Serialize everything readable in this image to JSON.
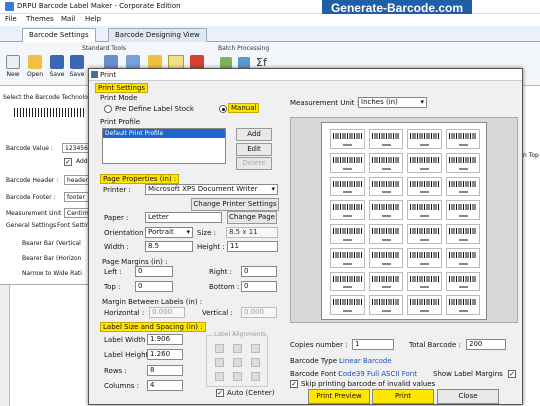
{
  "window": {
    "title": "DRPU Barcode Label Maker - Corporate Edition",
    "brand": "Generate-Barcode.com"
  },
  "menu": [
    "File",
    "Themes",
    "Mail",
    "Help"
  ],
  "tabs": [
    "Barcode Settings",
    "Barcode Designing View"
  ],
  "ribbon": {
    "standard_tools": "Standard Tools",
    "batch_processing": "Batch Processing",
    "buttons": [
      "New",
      "Open",
      "Save",
      "Save"
    ]
  },
  "left": {
    "technology": "Select the Barcode Technolog",
    "barcode_value_label": "Barcode Value :",
    "barcode_value": "123456",
    "add": "Add",
    "header_label": "Barcode Header :",
    "header": "header",
    "footer_label": "Barcode Footer :",
    "footer": "footer",
    "unit_label": "Measurement Unit :",
    "unit": "Centim",
    "general_tab": "General Settings",
    "font_tab": "Font Settin",
    "bearer_v": "Bearer Bar (Vertical",
    "bearer_h": "Bearer Bar (Horizon",
    "narrow_wide": "Narrow to Wide Rati",
    "right_top": "n Top"
  },
  "dialog": {
    "title": "Print",
    "print_settings": "Print Settings",
    "print_mode_label": "Print Mode",
    "mode_predefine": "Pre Define Label Stock",
    "mode_manual": "Manual",
    "print_profile_label": "Print Profile",
    "profile_items": [
      "Default Print Profile"
    ],
    "profile_add": "Add",
    "profile_edit": "Edit",
    "profile_delete": "Delete",
    "page_properties": "Page Properties (in) :",
    "printer_label": "Printer :",
    "printer": "Microsoft XPS Document Writer",
    "change_printer": "Change Printer Settings",
    "paper_label": "Paper :",
    "paper": "Letter",
    "change_page": "Change Page",
    "orientation_label": "Orientation :",
    "orientation": "Portrait",
    "size_label": "Size :",
    "size": "8.5 x 11",
    "width_label": "Width :",
    "width": "8.5",
    "height_label": "Height :",
    "height": "11",
    "page_margins": "Page Margins (in) :",
    "left_label": "Left :",
    "left": "0",
    "right_label": "Right :",
    "right": "0",
    "top_label": "Top :",
    "top": "0",
    "bottom_label": "Bottom :",
    "bottom": "0",
    "margin_between": "Margin Between Labels (in) :",
    "horizontal_label": "Horizontal :",
    "horizontal": "0.000",
    "vertical_label": "Vertical :",
    "vertical": "0.000",
    "label_size_spacing": "Label Size and Spacing (in) :",
    "label_width_label": "Label Width :",
    "label_width": "1.906",
    "label_height_label": "Label Height :",
    "label_height": "1.260",
    "rows_label": "Rows :",
    "rows": "8",
    "columns_label": "Columns :",
    "columns": "4",
    "label_alignments": "Label Alignments",
    "auto_center": "Auto (Center)",
    "measurement_unit_label": "Measurement Unit :",
    "measurement_unit": "Inches (in)",
    "copies_label": "Copies number :",
    "copies": "1",
    "total_label": "Total Barcode :",
    "total": "200",
    "barcode_type_label": "Barcode Type :",
    "barcode_type": "Linear Barcode",
    "barcode_font_label": "Barcode Font :",
    "barcode_font": "Code39 Full ASCII Font",
    "show_margins": "Show Label Margins",
    "skip_invalid": "Skip printing barcode of invalid values",
    "print_preview": "Print Preview",
    "print": "Print",
    "close": "Close"
  },
  "colors": {
    "highlight": "#ffe600",
    "brand_bg": "#1f5fa8",
    "link": "#1a4fc0"
  }
}
